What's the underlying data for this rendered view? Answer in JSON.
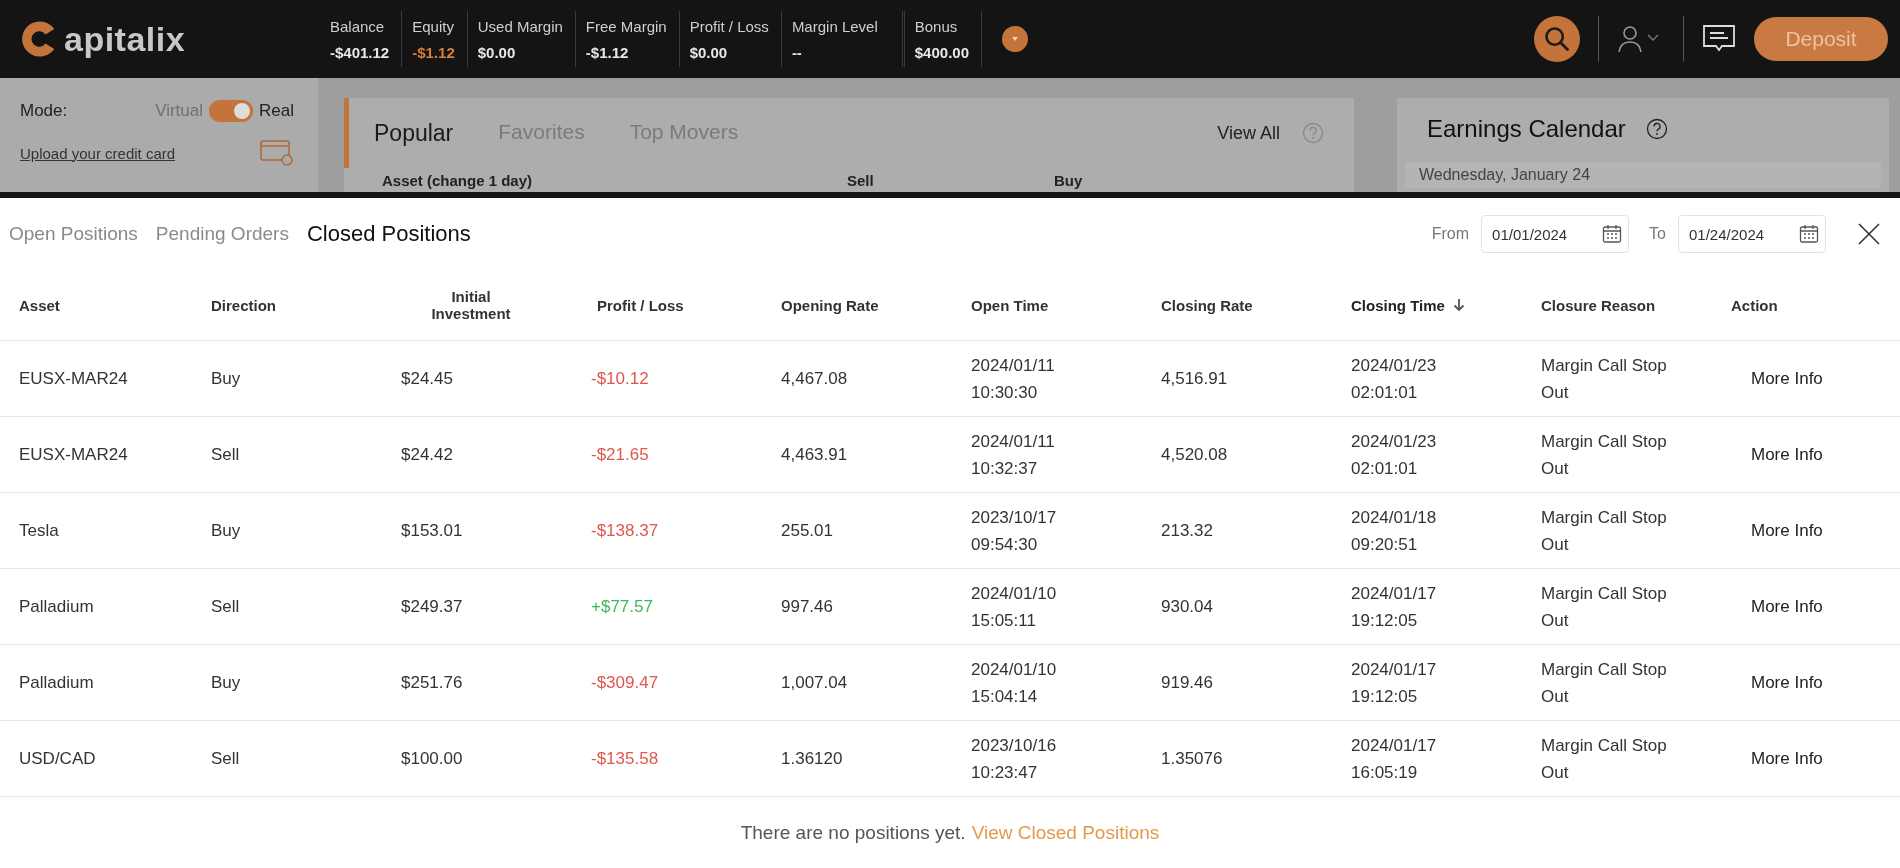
{
  "header": {
    "logo": "apitalix",
    "stats": [
      {
        "label": "Balance",
        "value": "-$401.12",
        "highlight": false
      },
      {
        "label": "Equity",
        "value": "-$1.12",
        "highlight": true
      },
      {
        "label": "Used Margin",
        "value": "$0.00",
        "highlight": false
      },
      {
        "label": "Free Margin",
        "value": "-$1.12",
        "highlight": false
      },
      {
        "label": "Profit / Loss",
        "value": "$0.00",
        "highlight": false
      },
      {
        "label": "Margin Level",
        "value": "--",
        "highlight": false
      },
      {
        "label": "Bonus",
        "value": "$400.00",
        "highlight": false
      }
    ],
    "deposit": "Deposit"
  },
  "sidebar": {
    "mode_label": "Mode:",
    "virtual": "Virtual",
    "real": "Real",
    "real_on": true,
    "upload_link": "Upload your credit card"
  },
  "popular": {
    "tabs": [
      {
        "label": "Popular",
        "selected": true
      },
      {
        "label": "Favorites",
        "selected": false
      },
      {
        "label": "Top Movers",
        "selected": false
      }
    ],
    "view_all": "View All",
    "columns": [
      "Asset (change 1 day)",
      "Sell",
      "Buy"
    ]
  },
  "earnings": {
    "title": "Earnings Calendar",
    "date": "Wednesday, January 24"
  },
  "positions": {
    "tabs": [
      {
        "label": "Open Positions",
        "selected": false
      },
      {
        "label": "Pending Orders",
        "selected": false
      },
      {
        "label": "Closed Positions",
        "selected": true
      }
    ],
    "from_label": "From",
    "from": "01/01/2024",
    "to_label": "To",
    "to": "01/24/2024",
    "columns": [
      {
        "label": "Asset",
        "sorted": false
      },
      {
        "label": "Direction",
        "sorted": false
      },
      {
        "label": "Initial Investment",
        "sorted": false
      },
      {
        "label": "Profit / Loss",
        "sorted": false
      },
      {
        "label": "Opening Rate",
        "sorted": false
      },
      {
        "label": "Open Time",
        "sorted": false
      },
      {
        "label": "Closing Rate",
        "sorted": false
      },
      {
        "label": "Closing Time",
        "sorted": true
      },
      {
        "label": "Closure Reason",
        "sorted": false
      },
      {
        "label": "Action",
        "sorted": false
      }
    ],
    "rows": [
      {
        "asset": "EUSX-MAR24",
        "direction": "Buy",
        "investment": "$24.45",
        "pl": "-$10.12",
        "gain": false,
        "open_rate": "4,467.08",
        "open_time": "2024/01/11 10:30:30",
        "close_rate": "4,516.91",
        "close_time": "2024/01/23 02:01:01",
        "reason": "Margin Call Stop Out",
        "action": "More Info"
      },
      {
        "asset": "EUSX-MAR24",
        "direction": "Sell",
        "investment": "$24.42",
        "pl": "-$21.65",
        "gain": false,
        "open_rate": "4,463.91",
        "open_time": "2024/01/11 10:32:37",
        "close_rate": "4,520.08",
        "close_time": "2024/01/23 02:01:01",
        "reason": "Margin Call Stop Out",
        "action": "More Info"
      },
      {
        "asset": "Tesla",
        "direction": "Buy",
        "investment": "$153.01",
        "pl": "-$138.37",
        "gain": false,
        "open_rate": "255.01",
        "open_time": "2023/10/17 09:54:30",
        "close_rate": "213.32",
        "close_time": "2024/01/18 09:20:51",
        "reason": "Margin Call Stop Out",
        "action": "More Info"
      },
      {
        "asset": "Palladium",
        "direction": "Sell",
        "investment": "$249.37",
        "pl": "+$77.57",
        "gain": true,
        "open_rate": "997.46",
        "open_time": "2024/01/10 15:05:11",
        "close_rate": "930.04",
        "close_time": "2024/01/17 19:12:05",
        "reason": "Margin Call Stop Out",
        "action": "More Info"
      },
      {
        "asset": "Palladium",
        "direction": "Buy",
        "investment": "$251.76",
        "pl": "-$309.47",
        "gain": false,
        "open_rate": "1,007.04",
        "open_time": "2024/01/10 15:04:14",
        "close_rate": "919.46",
        "close_time": "2024/01/17 19:12:05",
        "reason": "Margin Call Stop Out",
        "action": "More Info"
      },
      {
        "asset": "USD/CAD",
        "direction": "Sell",
        "investment": "$100.00",
        "pl": "-$135.58",
        "gain": false,
        "open_rate": "1.36120",
        "open_time": "2023/10/16 10:23:47",
        "close_rate": "1.35076",
        "close_time": "2024/01/17 16:05:19",
        "reason": "Margin Call Stop Out",
        "action": "More Info"
      }
    ],
    "empty_text": "There are no positions yet.",
    "empty_link": "View Closed Positions"
  }
}
